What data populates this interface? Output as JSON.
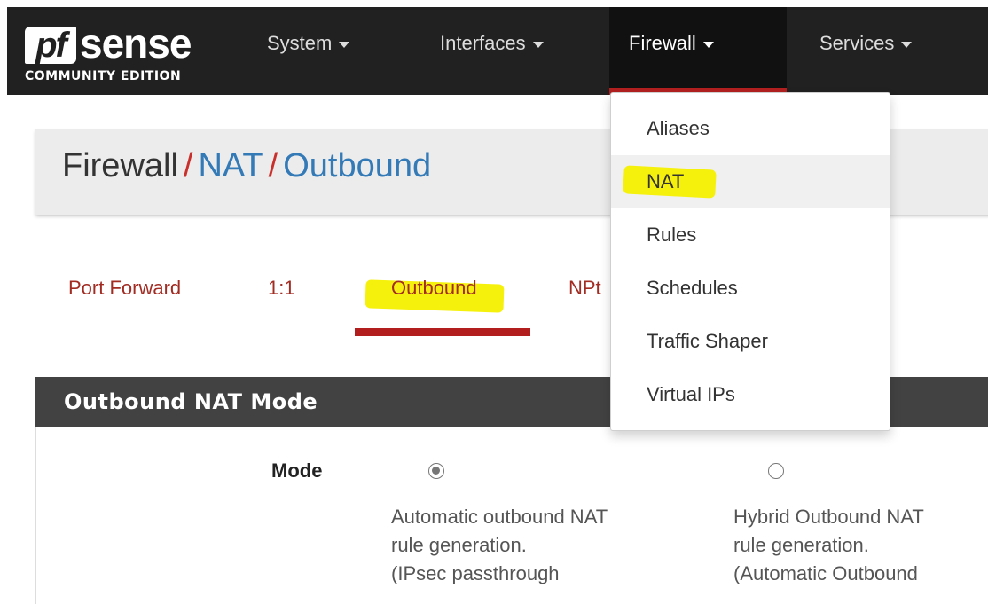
{
  "brand": {
    "logo_mark": "pf",
    "logo_word": "sense",
    "edition": "COMMUNITY EDITION"
  },
  "nav": {
    "items": [
      {
        "label": "System"
      },
      {
        "label": "Interfaces"
      },
      {
        "label": "Firewall",
        "active": true
      },
      {
        "label": "Services"
      }
    ]
  },
  "breadcrumb": {
    "root": "Firewall",
    "sep": "/",
    "level2": "NAT",
    "level3": "Outbound"
  },
  "tabs": [
    {
      "label": "Port Forward"
    },
    {
      "label": "1:1"
    },
    {
      "label": "Outbound",
      "active": true
    },
    {
      "label": "NPt"
    }
  ],
  "dropdown": {
    "items": [
      {
        "label": "Aliases"
      },
      {
        "label": "NAT",
        "highlighted": true
      },
      {
        "label": "Rules"
      },
      {
        "label": "Schedules"
      },
      {
        "label": "Traffic Shaper"
      },
      {
        "label": "Virtual IPs"
      }
    ]
  },
  "panel": {
    "title": "Outbound NAT Mode",
    "mode_label": "Mode",
    "options": [
      {
        "lines": [
          "Automatic outbound NAT",
          "rule generation.",
          "(IPsec passthrough"
        ],
        "checked": true
      },
      {
        "lines": [
          "Hybrid Outbound NAT",
          "rule generation.",
          "(Automatic Outbound"
        ],
        "checked": false
      }
    ]
  },
  "colors": {
    "navbar": "#212121",
    "accent_red": "#b21d1d",
    "link_blue": "#337ab7",
    "panel_head": "#424242",
    "highlight": "#f4f000"
  }
}
